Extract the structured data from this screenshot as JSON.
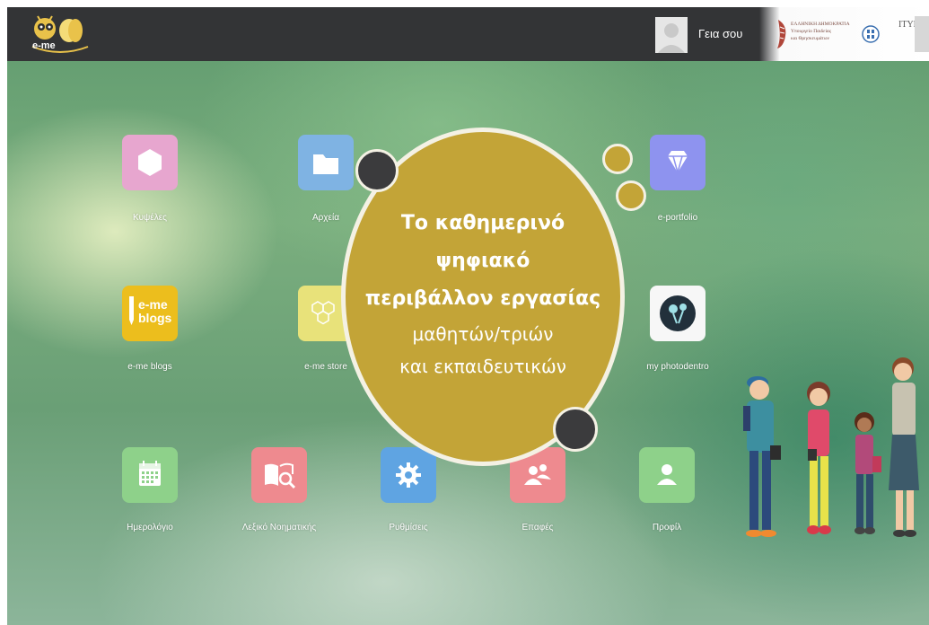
{
  "header": {
    "logo_text": "e-me",
    "greeting": "Γεια σου",
    "ministry_lines": [
      "ΕΛΛΗΝΙΚΗ ΔΗΜΟΚΡΑΤΙΑ",
      "Υπουργείο Παιδείας",
      "και Θρησκευμάτων"
    ],
    "itye_label": "ΙΤΥΕ"
  },
  "apps": [
    {
      "label": "Κυψέλες",
      "color": "#e7a6cf",
      "icon": "hexagon-icon"
    },
    {
      "label": "Αρχεία",
      "color": "#7fb3e3",
      "icon": "folder-icon"
    },
    {
      "label": "e-portfolio",
      "color": "#8e93ef",
      "icon": "diamond-icon"
    },
    {
      "label": "e-me blogs",
      "color": "#ecbe1d",
      "icon": "blogs-icon",
      "tile_text_1": "e-me",
      "tile_text_2": "blogs"
    },
    {
      "label": "e-me store",
      "color": "#e8e27a",
      "icon": "honeycomb-icon"
    },
    {
      "label": "my photodentro",
      "color": "#f7f7f7",
      "icon": "photodentro-icon"
    },
    {
      "label": "Ημερολόγιο",
      "color": "#8ed18a",
      "icon": "calendar-icon"
    },
    {
      "label": "Λεξικό Νοηματικής",
      "color": "#ee8a8f",
      "icon": "book-search-icon"
    },
    {
      "label": "Ρυθμίσεις",
      "color": "#5fa4e2",
      "icon": "gear-icon"
    },
    {
      "label": "Επαφές",
      "color": "#ee8a8f",
      "icon": "contacts-icon"
    },
    {
      "label": "Προφίλ",
      "color": "#8ed18a",
      "icon": "profile-icon"
    }
  ],
  "hero": {
    "line1": "Το καθημερινό",
    "line2": "ψηφιακό",
    "line3": "περιβάλλον εργασίας",
    "line4": "μαθητών/τριών",
    "line5": "και εκπαιδευτικών",
    "circle_color": "#c3a437",
    "accent_dark": "#3b3b3d"
  }
}
